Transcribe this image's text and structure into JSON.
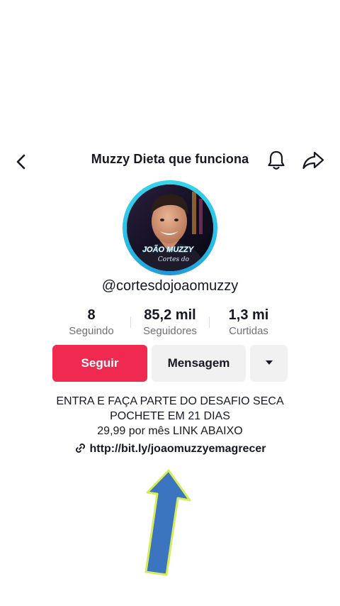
{
  "header": {
    "title": "Muzzy Dieta que funciona",
    "back_icon": "chevron-left-icon",
    "bell_icon": "bell-icon",
    "share_icon": "share-arrow-icon"
  },
  "profile": {
    "avatar_overlay_title": "JOÃO MUZZY",
    "avatar_overlay_subtitle": "Cortes do",
    "username": "@cortesdojoaomuzzy"
  },
  "stats": [
    {
      "value": "8",
      "label": "Seguindo"
    },
    {
      "value": "85,2 mil",
      "label": "Seguidores"
    },
    {
      "value": "1,3 mi",
      "label": "Curtidas"
    }
  ],
  "actions": {
    "follow_label": "Seguir",
    "message_label": "Mensagem",
    "more_icon": "caret-down-icon"
  },
  "bio": {
    "line1": "ENTRA E FAÇA PARTE DO DESAFIO SECA",
    "line2": "POCHETE EM 21 DIAS",
    "line3": "29,99 por mês LINK ABAIXO",
    "link_icon": "link-icon",
    "link": "http://bit.ly/joaomuzzyemagrecer"
  },
  "annotation": {
    "icon": "up-arrow-icon",
    "fill_color": "#3b74bf",
    "outline_color": "#d7ec5a"
  },
  "colors": {
    "follow_button": "#ef2950",
    "secondary_button": "#f1f1f2",
    "avatar_ring": "#2fc4e6"
  }
}
